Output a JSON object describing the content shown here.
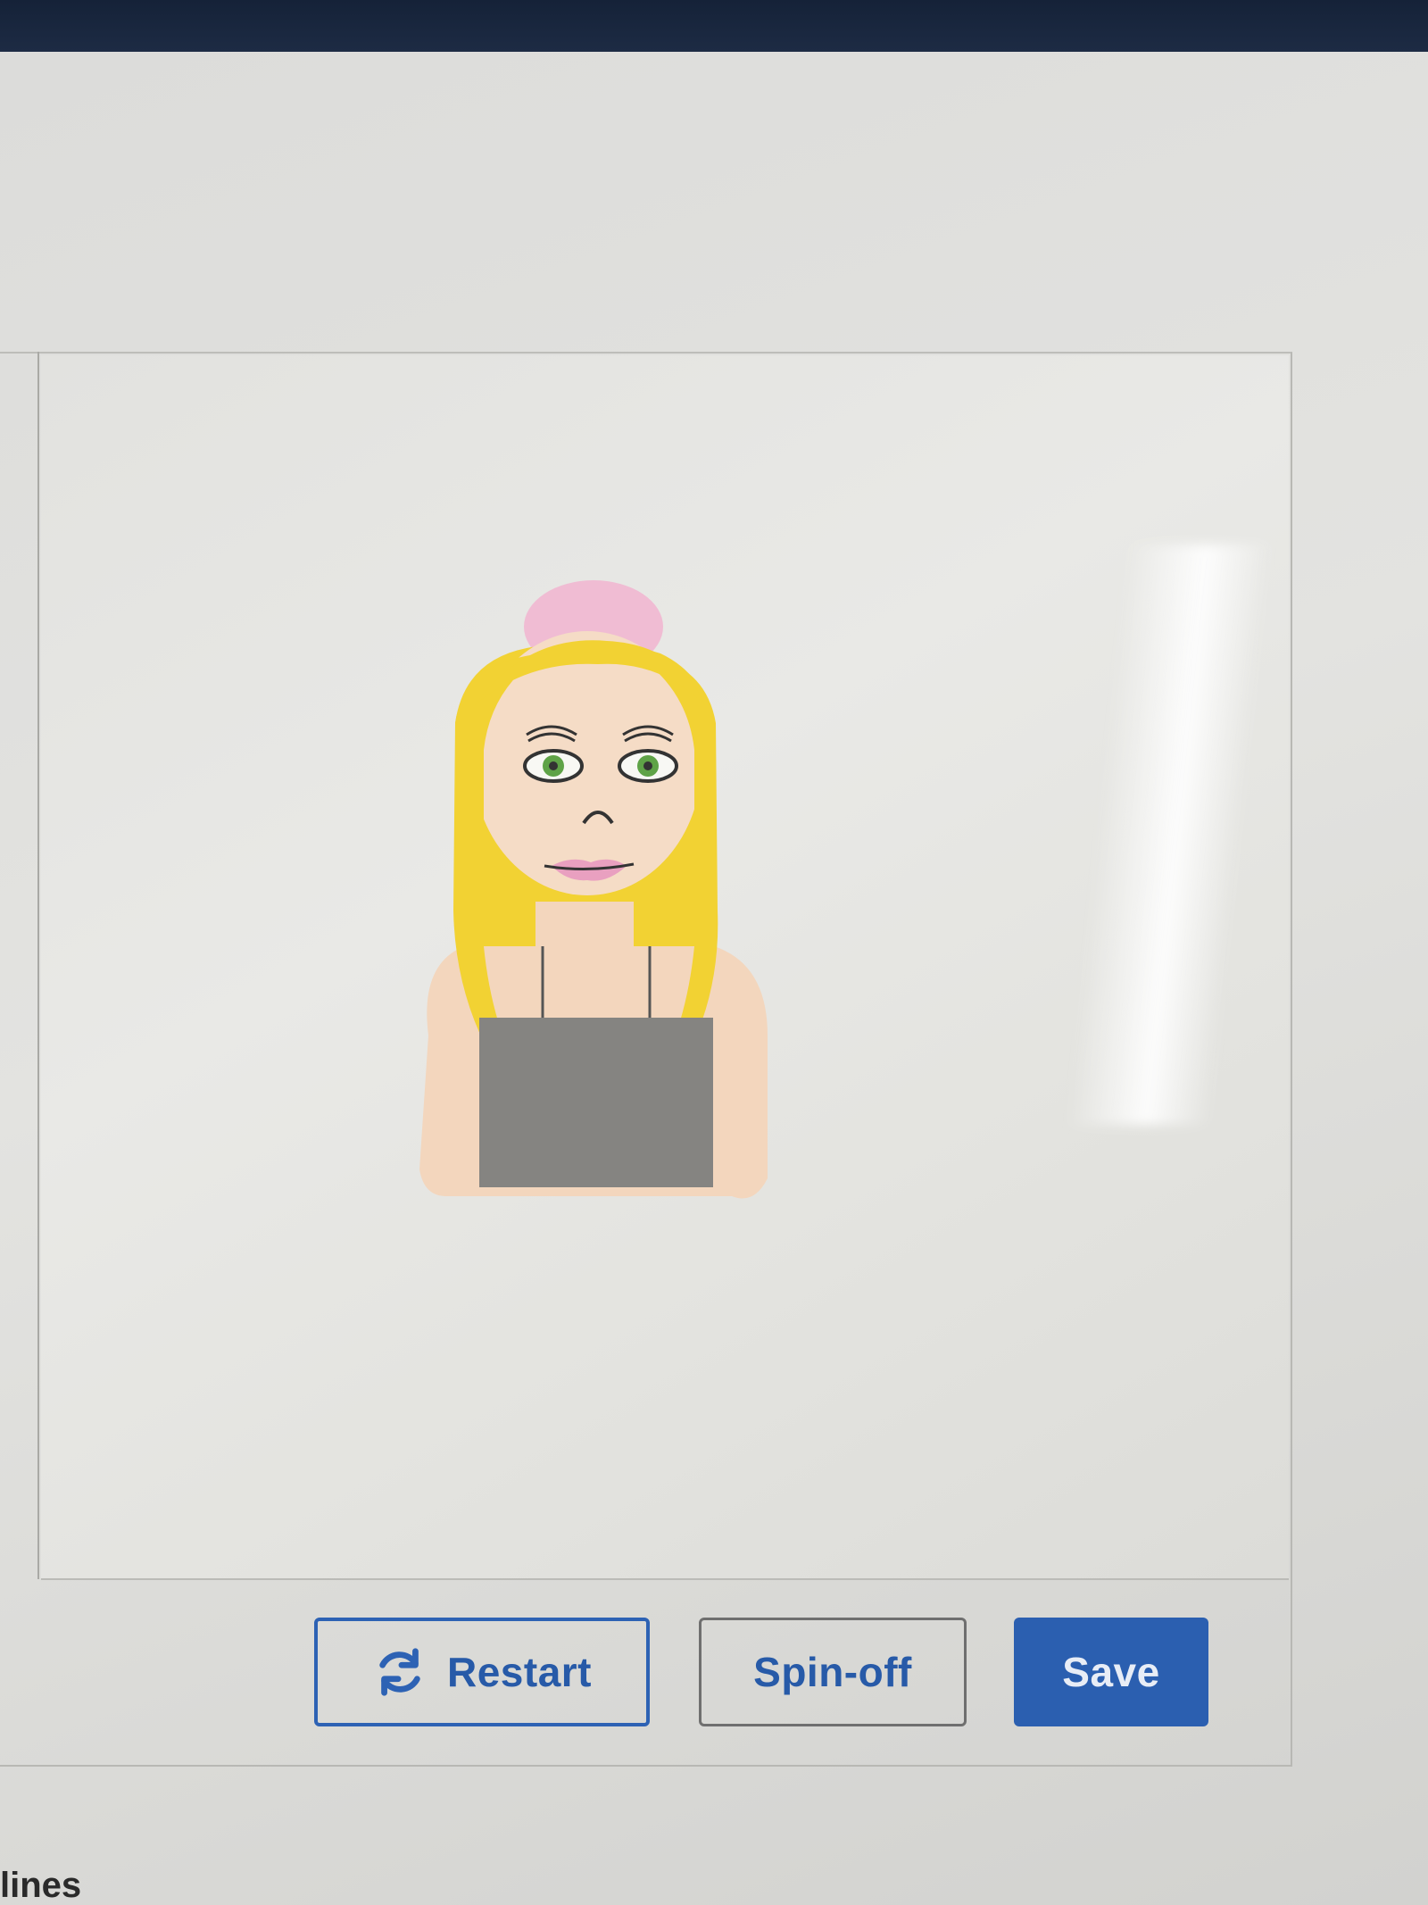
{
  "toolbar": {
    "restart_label": "Restart",
    "restart_icon": "refresh-icon",
    "spinoff_label": "Spin-off",
    "save_label": "Save"
  },
  "footer": {
    "partial_text": "lines"
  },
  "colors": {
    "top_bar": "#1d2b44",
    "accent": "#2b5fb0",
    "hair": "#f2d233",
    "skin": "#f3d6bd",
    "hat": "#f0bcd3",
    "eyes": "#5fa347",
    "lips": "#e9a0c0",
    "top": "#858481"
  }
}
